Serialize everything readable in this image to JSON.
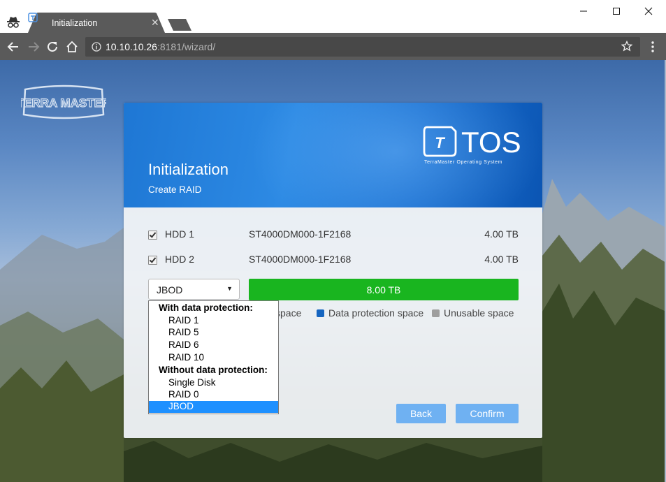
{
  "browser": {
    "tab_title": "Initialization",
    "url_host": "10.10.10.26",
    "url_rest": ":8181/wizard/"
  },
  "brand": {
    "logo_text": "TERRA MASTER",
    "tos_text": "TOS",
    "tos_subtitle": "TerraMaster Operating System",
    "tos_letter": "T"
  },
  "wizard": {
    "title": "Initialization",
    "subtitle": "Create RAID",
    "disks": [
      {
        "name": "HDD 1",
        "model": "ST4000DM000-1F2168",
        "size": "4.00 TB",
        "checked": true
      },
      {
        "name": "HDD 2",
        "model": "ST4000DM000-1F2168",
        "size": "4.00 TB",
        "checked": true
      }
    ],
    "raid_select_value": "JBOD",
    "capacity_label": "8.00 TB",
    "legend": [
      {
        "label": "space",
        "color": "#19b51f"
      },
      {
        "label": "Data protection space",
        "color": "#1565c0"
      },
      {
        "label": "Unusable space",
        "color": "#9e9e9e"
      }
    ],
    "back_label": "Back",
    "confirm_label": "Confirm"
  },
  "dropdown": {
    "group1": "With data protection:",
    "group1_options": [
      "RAID 1",
      "RAID 5",
      "RAID 6",
      "RAID 10"
    ],
    "group2": "Without data protection:",
    "group2_options": [
      "Single Disk",
      "RAID 0",
      "JBOD"
    ],
    "selected": "JBOD"
  },
  "colors": {
    "accent": "#1e90ff",
    "capacity_bar": "#19b51f",
    "button": "#6fb1f2"
  }
}
